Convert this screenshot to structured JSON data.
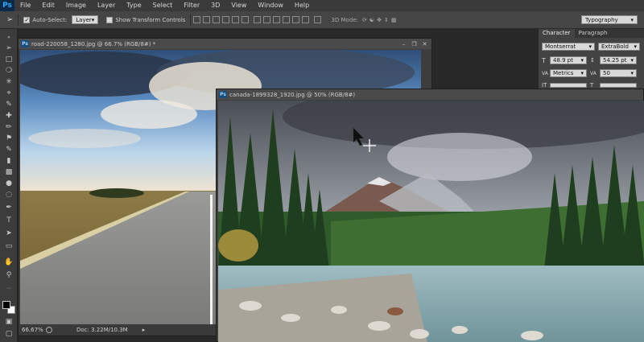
{
  "app": {
    "logo": "Ps"
  },
  "menu": [
    "File",
    "Edit",
    "Image",
    "Layer",
    "Type",
    "Select",
    "Filter",
    "3D",
    "View",
    "Window",
    "Help"
  ],
  "options": {
    "auto_select_label": "Auto-Select:",
    "auto_select_value": "Layer",
    "show_transform_label": "Show Transform Controls",
    "mode_3d_label": "3D Mode:",
    "workspace": "Typography"
  },
  "doc1": {
    "title": "road-220058_1280.jpg @ 66.7% (RGB/8#) *",
    "zoom": "66.67%",
    "doc_info": "Doc: 3.22M/10.3M"
  },
  "doc2": {
    "title": "canada-1899328_1920.jpg @ 50% (RGB/8#)"
  },
  "panel": {
    "tabs": [
      "Character",
      "Paragraph"
    ],
    "font_family": "Montserrat",
    "font_style": "ExtraBold",
    "font_size": "48.9 pt",
    "leading": "54.25 pt",
    "kerning": "Metrics",
    "tracking": "50"
  },
  "colors": {
    "menubar": "#3a3a3a",
    "options": "#454545",
    "panel": "#434343",
    "accent": "#31a8ff"
  }
}
